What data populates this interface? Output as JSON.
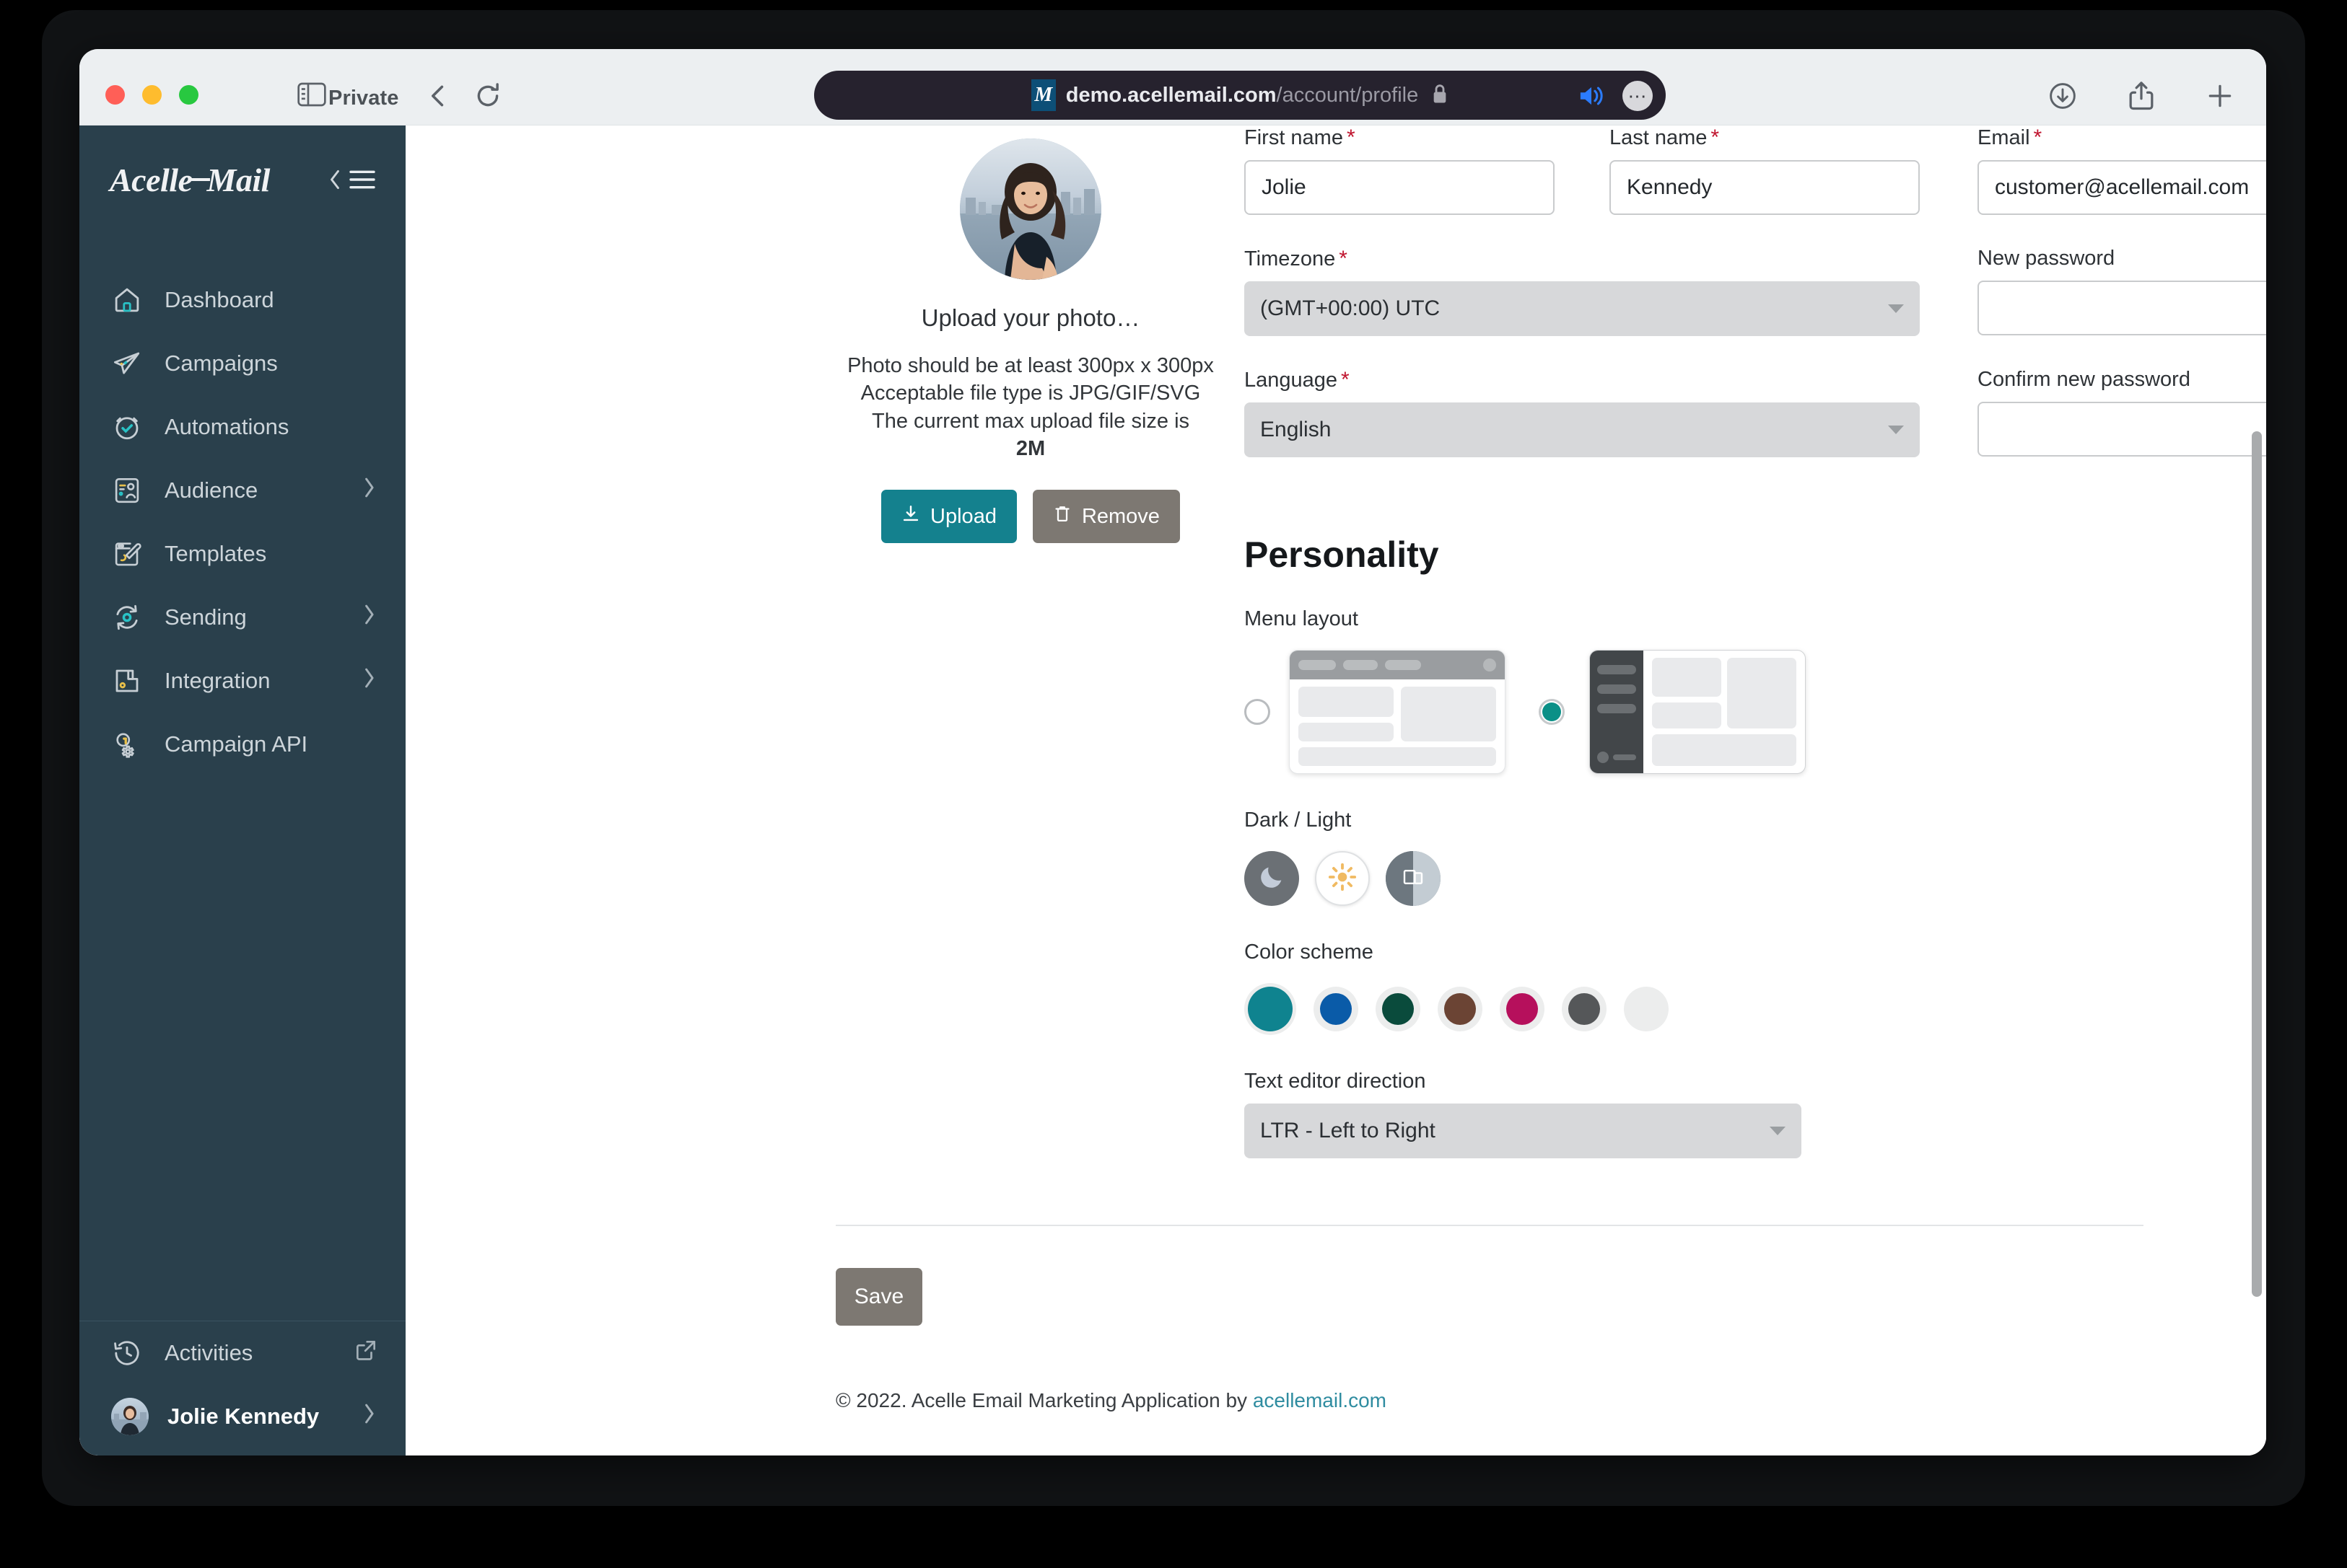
{
  "browser": {
    "private_label": "Private",
    "url_host": "demo.acellemail.com",
    "url_path": "/account/profile",
    "site_badge": "M",
    "icons": {
      "sidebar": "sidebar-toggle-icon",
      "back": "back-icon",
      "reload": "reload-icon",
      "lock": "lock-icon",
      "speaker": "speaker-icon",
      "more": "⋯",
      "download": "download-icon",
      "share": "share-icon",
      "newtab": "new-tab-icon"
    }
  },
  "sidebar": {
    "brand": {
      "part1": "Acelle",
      "part2": "Mail"
    },
    "items": [
      {
        "label": "Dashboard",
        "icon": "home-icon",
        "has_chevron": false
      },
      {
        "label": "Campaigns",
        "icon": "paper-plane-icon",
        "has_chevron": false
      },
      {
        "label": "Automations",
        "icon": "clock-check-icon",
        "has_chevron": false
      },
      {
        "label": "Audience",
        "icon": "contact-card-icon",
        "has_chevron": true
      },
      {
        "label": "Templates",
        "icon": "brush-icon",
        "has_chevron": false
      },
      {
        "label": "Sending",
        "icon": "sync-gear-icon",
        "has_chevron": true
      },
      {
        "label": "Integration",
        "icon": "plugin-icon",
        "has_chevron": true
      },
      {
        "label": "Campaign API",
        "icon": "api-gear-icon",
        "has_chevron": false
      }
    ],
    "bottom": {
      "activities_label": "Activities",
      "activities_icon": "history-icon",
      "external_icon": "external-link-icon",
      "user_name": "Jolie Kennedy",
      "user_chevron": "chevron-right-icon"
    }
  },
  "photo": {
    "title": "Upload your photo…",
    "help_line1": "Photo should be at least 300px x 300px",
    "help_line2": "Acceptable file type is JPG/GIF/SVG",
    "help_line3": "The current max upload file size is",
    "max_size": "2M",
    "upload_label": "Upload",
    "upload_icon": "download-arrow-icon",
    "remove_label": "Remove",
    "remove_icon": "trash-icon"
  },
  "form": {
    "first_name": {
      "label": "First name",
      "required": "*",
      "value": "Jolie"
    },
    "last_name": {
      "label": "Last name",
      "required": "*",
      "value": "Kennedy"
    },
    "email": {
      "label": "Email",
      "required": "*",
      "value": "customer@acellemail.com"
    },
    "timezone": {
      "label": "Timezone",
      "required": "*",
      "value": "(GMT+00:00) UTC"
    },
    "language": {
      "label": "Language",
      "required": "*",
      "value": "English"
    },
    "new_password": {
      "label": "New password",
      "value": ""
    },
    "confirm_password": {
      "label": "Confirm new password",
      "value": ""
    }
  },
  "personality": {
    "heading": "Personality",
    "menu_layout_label": "Menu layout",
    "menu_layout_selected": "sidebar",
    "dark_light_label": "Dark / Light",
    "theme_selected": "light",
    "themes": [
      {
        "name": "dark",
        "icon": "moon-icon"
      },
      {
        "name": "light",
        "icon": "sun-icon"
      },
      {
        "name": "auto",
        "icon": "device-icon"
      }
    ],
    "color_scheme_label": "Color scheme",
    "colors": [
      {
        "name": "teal",
        "hex": "#0f838f",
        "selected": true
      },
      {
        "name": "blue",
        "hex": "#0a5ba8",
        "selected": false
      },
      {
        "name": "green",
        "hex": "#0a4b3c",
        "selected": false
      },
      {
        "name": "brown",
        "hex": "#6b4434",
        "selected": false
      },
      {
        "name": "magenta",
        "hex": "#b6105c",
        "selected": false
      },
      {
        "name": "gray",
        "hex": "#555759",
        "selected": false
      },
      {
        "name": "light-gray",
        "hex": "#eceded",
        "selected": false
      }
    ],
    "text_direction_label": "Text editor direction",
    "text_direction_value": "LTR - Left to Right"
  },
  "actions": {
    "save_label": "Save"
  },
  "footer": {
    "text": "© 2022. Acelle Email Marketing Application by ",
    "link": "acellemail.com"
  }
}
